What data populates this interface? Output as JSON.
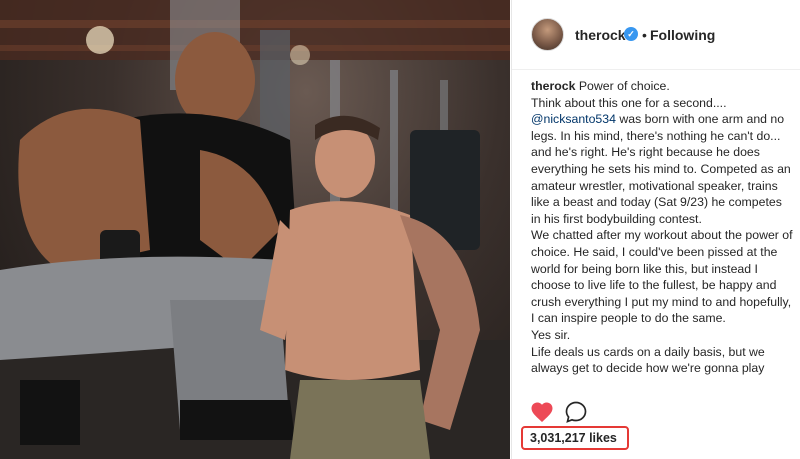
{
  "post": {
    "username": "therock",
    "verified_glyph": "✓",
    "dot": "•",
    "follow_status": "Following",
    "caption": {
      "author": "therock",
      "line1_rest": "Power of choice.",
      "line2": "Think about this one for a second....",
      "mention": "@nicksanto534",
      "para1_rest": "was born with one arm and no legs. In his mind, there's nothing he can't do... and he's right. He's right because he does everything he sets his mind to. Competed as an amateur wrestler, motivational speaker, trains like a beast and today (Sat 9/23) he competes in his first bodybuilding contest.",
      "para2": "We chatted after my workout about the power of choice. He said, I could've been pissed at the world for being born like this, but instead I choose to live life to the fullest, be happy and crush everything I put my mind to and hopefully, I can inspire people to do the same.",
      "line_yes": "Yes sir.",
      "para3": "Life deals us cards on a daily basis, but we always get to decide how we're gonna play"
    },
    "icons": {
      "like": "heart-icon",
      "comment": "comment-icon"
    },
    "likes_text": "3,031,217 likes",
    "colors": {
      "heart": "#ed4956",
      "highlight_box": "#e53935",
      "verified": "#3897f0",
      "mention": "#003569"
    }
  }
}
